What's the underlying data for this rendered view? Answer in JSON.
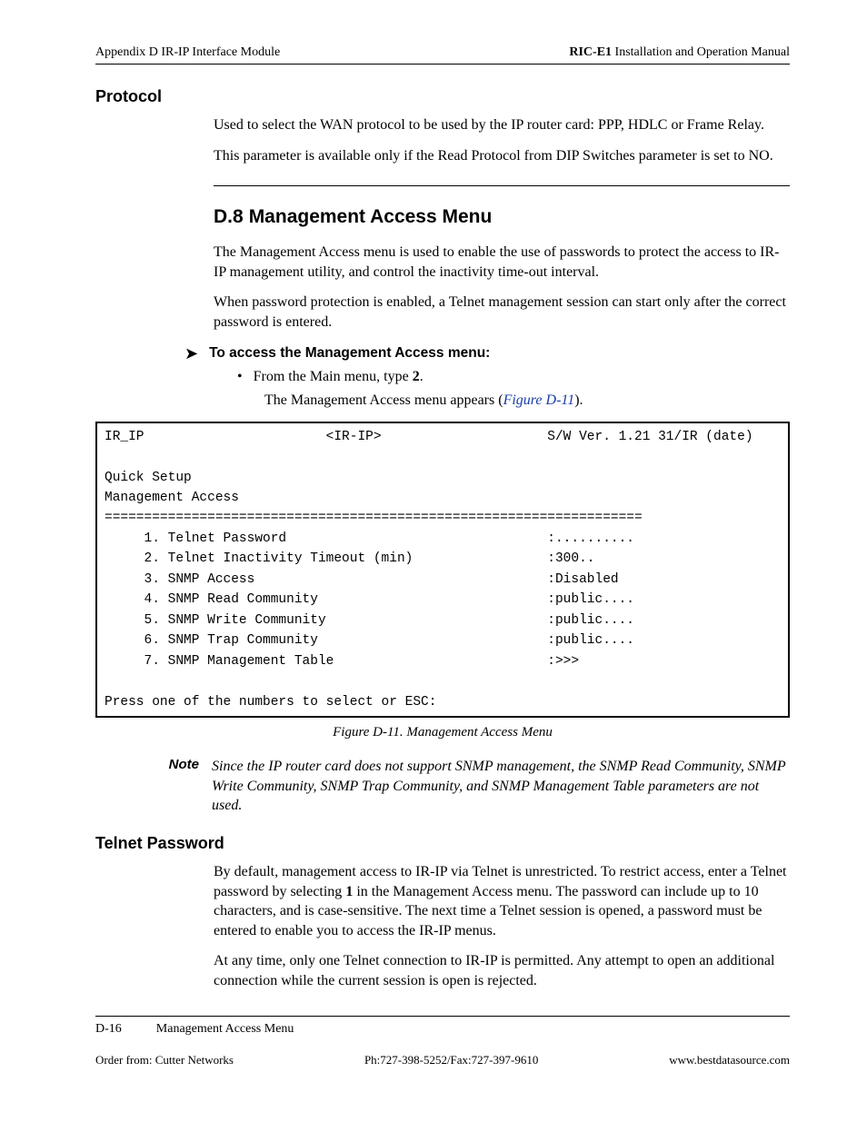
{
  "header": {
    "left": "Appendix D  IR-IP Interface Module",
    "right_bold": "RIC-E1",
    "right_rest": " Installation and Operation Manual"
  },
  "protocol": {
    "heading": "Protocol",
    "p1": "Used to select the WAN protocol to be used by the IP router card: PPP, HDLC or Frame Relay.",
    "p2": "This parameter is available only if the Read Protocol from DIP Switches parameter is set to NO."
  },
  "d8": {
    "num": "D.8",
    "title": "Management Access Menu",
    "p1": "The Management Access menu is used to enable the use of passwords to protect the access to IR-IP management utility, and control the inactivity time-out interval.",
    "p2": "When password protection is enabled, a Telnet management session can start only after the correct password is entered.",
    "arrow_text": "To access the Management Access menu:",
    "bullet_prefix": "From the Main menu, type ",
    "bullet_key": "2",
    "bullet_suffix": ".",
    "sub_bullet_prefix": "The Management Access menu appears (",
    "figref": "Figure D-11",
    "sub_bullet_suffix": ")."
  },
  "terminal": {
    "title_row": {
      "left": "IR_IP",
      "center": "<IR-IP>",
      "right": "S/W Ver. 1.21 31/IR (date)"
    },
    "quick_setup": "Quick Setup",
    "mgmt_access": "Management Access",
    "divider": "====================================================================",
    "items": [
      {
        "label": "1. Telnet Password",
        "value": ":.........."
      },
      {
        "label": "2. Telnet Inactivity Timeout (min)",
        "value": ":300.."
      },
      {
        "label": "3. SNMP Access",
        "value": ":Disabled"
      },
      {
        "label": "4. SNMP Read Community",
        "value": ":public...."
      },
      {
        "label": "5. SNMP Write Community",
        "value": ":public...."
      },
      {
        "label": "6. SNMP Trap Community",
        "value": ":public...."
      },
      {
        "label": "7. SNMP Management Table",
        "value": ":>>>"
      }
    ],
    "prompt": "Press one of the numbers to select or ESC:"
  },
  "figure_caption": "Figure D-11.  Management Access Menu",
  "note": {
    "label": "Note",
    "text": "Since the IP router card does not support SNMP management, the SNMP Read Community, SNMP Write Community, SNMP Trap Community, and SNMP Management Table parameters are not used."
  },
  "telnet": {
    "heading": "Telnet Password",
    "p1a": "By default, management access to IR-IP via Telnet is unrestricted. To restrict access, enter a Telnet password by selecting ",
    "p1_key": "1",
    "p1b": " in the Management Access menu. The password can include up to 10 characters, and is case-sensitive. The next time a Telnet session is opened, a password must be entered to enable you to access the IR-IP menus.",
    "p2": "At any time, only one Telnet connection to IR-IP is permitted. Any attempt to open an additional connection while the current session is open is rejected."
  },
  "footer": {
    "pagenum": "D-16",
    "section": "Management Access Menu",
    "order": "Order from: Cutter Networks",
    "phone": "Ph:727-398-5252/Fax:727-397-9610",
    "url": "www.bestdatasource.com"
  }
}
